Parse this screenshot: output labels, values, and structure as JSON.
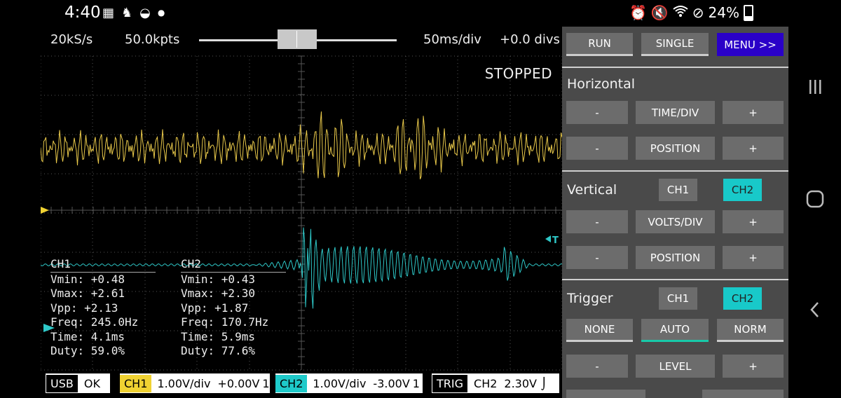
{
  "status_bar": {
    "time": "4:40",
    "battery": "24%",
    "left_icons": [
      "gallery-icon",
      "person-icon",
      "ball-icon",
      "dot-icon"
    ],
    "right_icons": [
      "alarm-icon",
      "mute-icon",
      "wifi-icon",
      "block-icon",
      "battery-icon"
    ]
  },
  "scope": {
    "sample_rate": "20kS/s",
    "points": "50.0kpts",
    "timebase": "50ms/div",
    "offset": "+0.0 divs",
    "state": "STOPPED",
    "trigger_marker": "T",
    "colors": {
      "ch1": "#e8c84a",
      "ch2": "#2ec8c8",
      "grid": "#555555"
    },
    "ch1_meas": {
      "name": "CH1",
      "vmin": "Vmin: +0.48",
      "vmax": "Vmax: +2.61",
      "vpp": "Vpp: +2.13",
      "freq": "Freq: 245.0Hz",
      "time": "Time: 4.1ms",
      "duty": "Duty: 59.0%"
    },
    "ch2_meas": {
      "name": "CH2",
      "vmin": "Vmin: +0.43",
      "vmax": "Vmax: +2.30",
      "vpp": "Vpp: +1.87",
      "freq": "Freq: 170.7Hz",
      "time": "Time: 5.9ms",
      "duty": "Duty: 77.6%"
    }
  },
  "bottom_bar": {
    "usb_tag": "USB",
    "usb_status": "OK",
    "ch1_tag": "CH1",
    "ch1_volts": "1.00V/div",
    "ch1_offset": "+0.00V",
    "ch1_coupling": "1",
    "ch2_tag": "CH2",
    "ch2_volts": "1.00V/div",
    "ch2_offset": "-3.00V",
    "ch2_coupling": "1",
    "trig_tag": "TRIG",
    "trig_source": "CH2",
    "trig_level": "2.30V",
    "trig_edge": "⌡"
  },
  "panel": {
    "run": "RUN",
    "single": "SINGLE",
    "menu": "MENU >>",
    "horizontal": {
      "title": "Horizontal",
      "minus": "-",
      "time_div": "TIME/DIV",
      "plus": "+",
      "position": "POSITION"
    },
    "vertical": {
      "title": "Vertical",
      "ch1": "CH1",
      "ch2": "CH2",
      "minus": "-",
      "volts_div": "VOLTS/DIV",
      "plus": "+",
      "position": "POSITION"
    },
    "trigger": {
      "title": "Trigger",
      "ch1": "CH1",
      "ch2": "CH2",
      "none": "NONE",
      "auto": "AUTO",
      "norm": "NORM",
      "minus": "-",
      "level": "LEVEL",
      "plus": "+"
    }
  },
  "nav": {
    "recents": "recents-icon",
    "home": "home-icon",
    "back": "back-icon"
  }
}
